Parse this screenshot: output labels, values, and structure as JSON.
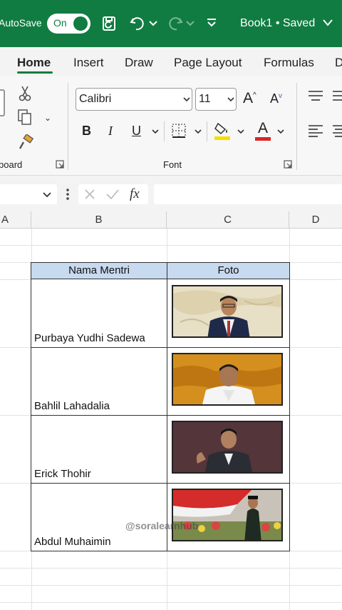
{
  "titlebar": {
    "autosave_label": "AutoSave",
    "toggle_state": "On",
    "title": "Book1 • Saved",
    "bg_color": "#107c41"
  },
  "ribbon": {
    "tabs": [
      {
        "label": "Home",
        "active": true
      },
      {
        "label": "Insert"
      },
      {
        "label": "Draw"
      },
      {
        "label": "Page Layout"
      },
      {
        "label": "Formulas"
      },
      {
        "label": "D"
      }
    ],
    "clipboard_group_label": "board",
    "font_group_label": "Font",
    "font_name": "Calibri",
    "font_size": "11",
    "bold_label": "B",
    "italic_label": "I",
    "underline_label": "U",
    "font_color_label": "A",
    "grow_label": "A",
    "shrink_label": "A"
  },
  "formula_bar": {
    "fx_label": "fx",
    "value": ""
  },
  "grid": {
    "columns": [
      "A",
      "B",
      "C",
      "D"
    ],
    "table_headers": [
      "Nama Mentri",
      "Foto"
    ],
    "rows": [
      {
        "name": "Purbaya Yudhi Sadewa",
        "photo": "photo-1"
      },
      {
        "name": "Bahlil Lahadalia",
        "photo": "photo-2"
      },
      {
        "name": "Erick Thohir",
        "photo": "photo-3"
      },
      {
        "name": "Abdul Muhaimin",
        "photo": "photo-4"
      }
    ]
  },
  "watermark": "@soralearnhub"
}
